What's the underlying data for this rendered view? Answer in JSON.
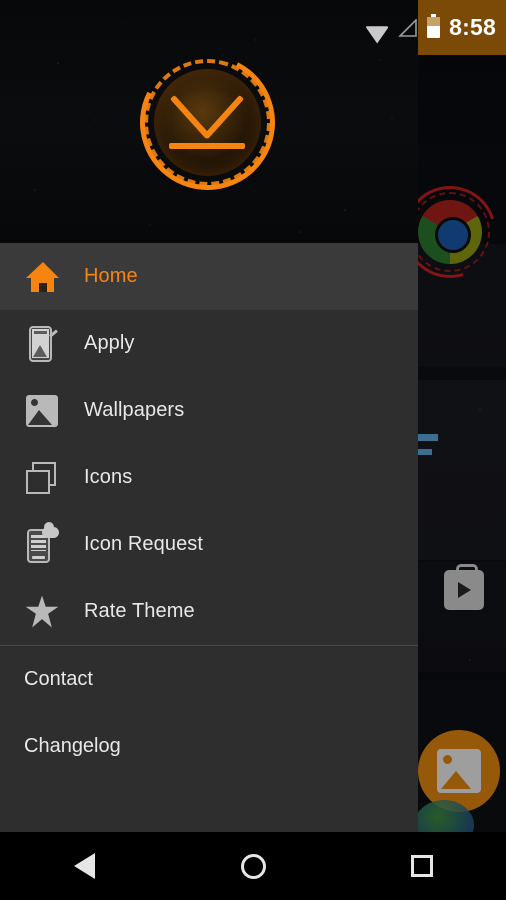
{
  "statusbar": {
    "time": "8:58",
    "icons": [
      "wifi-icon",
      "cellular-signal-icon",
      "battery-icon"
    ],
    "tint_color": "#7a4a06"
  },
  "drawer": {
    "accent_color": "#f58410",
    "background_color": "#2e2e2e",
    "selected_background_color": "#3a3a3a",
    "header": {
      "logo_name": "app-logo",
      "background": "starfield"
    },
    "menu_items": [
      {
        "label": "Home",
        "icon": "home-icon",
        "selected": true
      },
      {
        "label": "Apply",
        "icon": "apply-phone-icon",
        "selected": false
      },
      {
        "label": "Wallpapers",
        "icon": "wallpaper-image-icon",
        "selected": false
      },
      {
        "label": "Icons",
        "icon": "icons-squares-icon",
        "selected": false
      },
      {
        "label": "Icon Request",
        "icon": "icon-request-cloud-icon",
        "selected": false
      },
      {
        "label": "Rate Theme",
        "icon": "star-icon",
        "selected": false
      }
    ],
    "secondary_items": [
      {
        "label": "Contact"
      },
      {
        "label": "Changelog"
      }
    ]
  },
  "background": {
    "app_icons": [
      "chrome-icon",
      "facebook-icon",
      "play-store-icon",
      "gallery-icon"
    ]
  },
  "navbar": {
    "buttons": [
      {
        "name": "back-button",
        "icon": "triangle-back-icon"
      },
      {
        "name": "home-button",
        "icon": "circle-home-icon"
      },
      {
        "name": "recents-button",
        "icon": "square-recents-icon"
      }
    ]
  }
}
